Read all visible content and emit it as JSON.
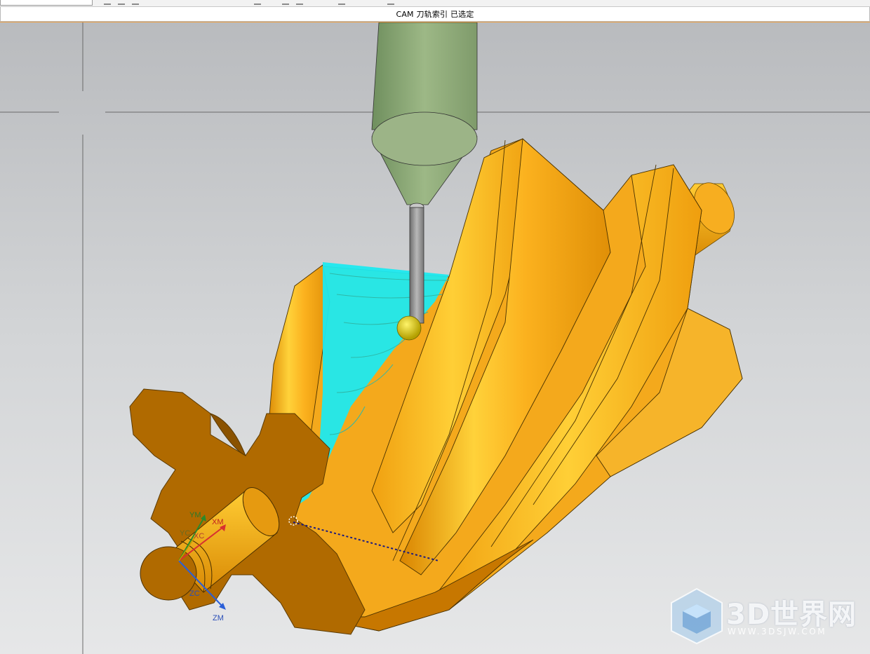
{
  "status": {
    "message": "CAM 刀轨索引 已选定"
  },
  "axes": {
    "ym": "YM",
    "yc": "YC",
    "xm": "XM",
    "xc": "XC",
    "zc": "ZC",
    "zm": "ZM"
  },
  "watermark": {
    "brand": "3D世界网",
    "url": "WWW.3DSJW.COM"
  },
  "colors": {
    "part": "#f7a81c",
    "part_dark": "#a86400",
    "tool_holder": "#8da877",
    "toolpath": "#15e8ee",
    "background": "#d2d4d6",
    "accent_line": "#f0a040"
  },
  "icons": [
    "toolbar-icons",
    "cube-logo-icon"
  ]
}
